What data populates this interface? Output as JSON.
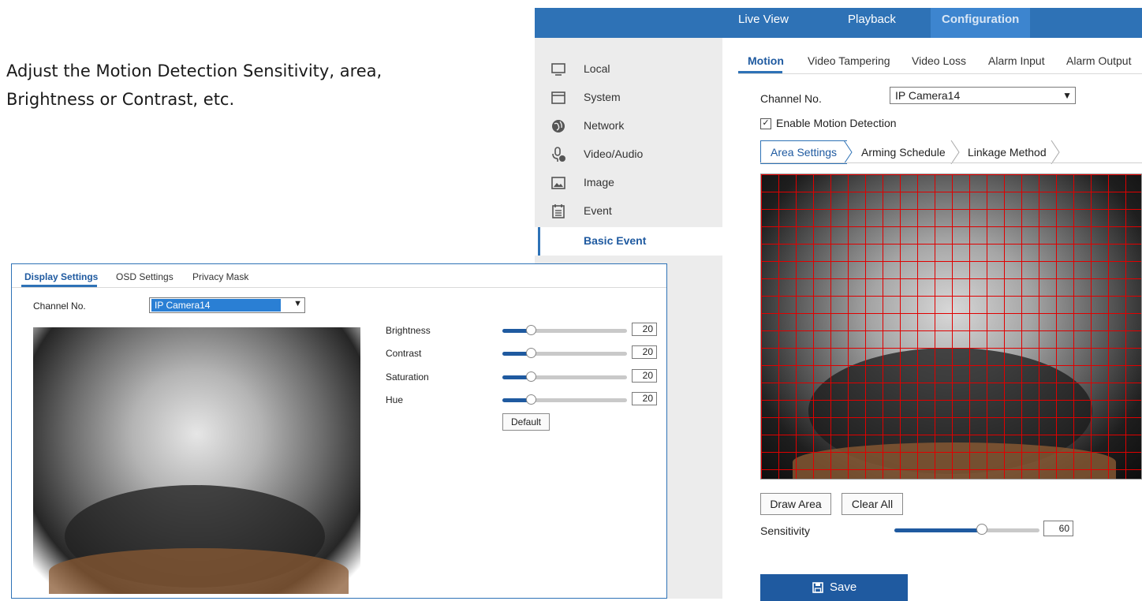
{
  "instruction": {
    "line1": "Adjust the Motion Detection Sensitivity, area,",
    "line2": "Brightness or Contrast, etc."
  },
  "topnav": {
    "live_view": "Live View",
    "playback": "Playback",
    "configuration": "Configuration"
  },
  "sidebar": {
    "items": [
      {
        "label": "Local",
        "icon": "monitor-icon"
      },
      {
        "label": "System",
        "icon": "system-icon"
      },
      {
        "label": "Network",
        "icon": "globe-icon"
      },
      {
        "label": "Video/Audio",
        "icon": "microphone-icon"
      },
      {
        "label": "Image",
        "icon": "image-icon"
      },
      {
        "label": "Event",
        "icon": "calendar-icon"
      }
    ],
    "sub_item": "Basic Event"
  },
  "event_tabs": [
    "Motion",
    "Video Tampering",
    "Video Loss",
    "Alarm Input",
    "Alarm Output"
  ],
  "motion": {
    "channel_label": "Channel No.",
    "channel_value": "IP Camera14",
    "enable_label": "Enable Motion Detection",
    "enabled": true,
    "steps": [
      "Area Settings",
      "Arming Schedule",
      "Linkage Method"
    ],
    "draw_area": "Draw Area",
    "clear_all": "Clear All",
    "sensitivity_label": "Sensitivity",
    "sensitivity": "60",
    "save": "Save"
  },
  "display_dialog": {
    "tabs": [
      "Display Settings",
      "OSD Settings",
      "Privacy Mask"
    ],
    "channel_label": "Channel No.",
    "channel_value": "IP Camera14",
    "params": [
      {
        "label": "Brightness",
        "value": "20"
      },
      {
        "label": "Contrast",
        "value": "20"
      },
      {
        "label": "Saturation",
        "value": "20"
      },
      {
        "label": "Hue",
        "value": "20"
      }
    ],
    "default_button": "Default"
  },
  "colors": {
    "accent": "#2e72b6",
    "active_text": "#1f5aa0",
    "grid": "#e00000",
    "sidebar_bg": "#ececec"
  }
}
